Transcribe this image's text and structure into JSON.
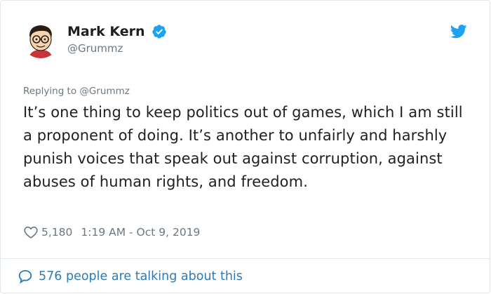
{
  "author": {
    "display_name": "Mark Kern",
    "handle": "@Grummz",
    "avatar_icon": "cartoon-avatar-icon",
    "verified_icon": "verified-badge-icon"
  },
  "tweet": {
    "replying_to": "Replying to @Grummz",
    "text": "It’s one thing to keep politics out of games, which I am still a proponent of doing. It’s another to unfairly and harshly punish voices that speak out against corruption, against abuses of human rights, and freedom.",
    "like_count": "5,180",
    "timestamp": "1:19 AM - Oct 9, 2019"
  },
  "footer": {
    "talking_text": "576 people are talking about this"
  },
  "colors": {
    "twitter_blue": "#1da1f2",
    "link_blue": "#2b7bb9",
    "muted_gray": "#697882",
    "text": "#1c2022",
    "border": "#e1e8ed"
  },
  "icons": {
    "brand": "twitter-bird-icon",
    "like": "heart-icon",
    "conversation": "speech-bubble-icon"
  }
}
